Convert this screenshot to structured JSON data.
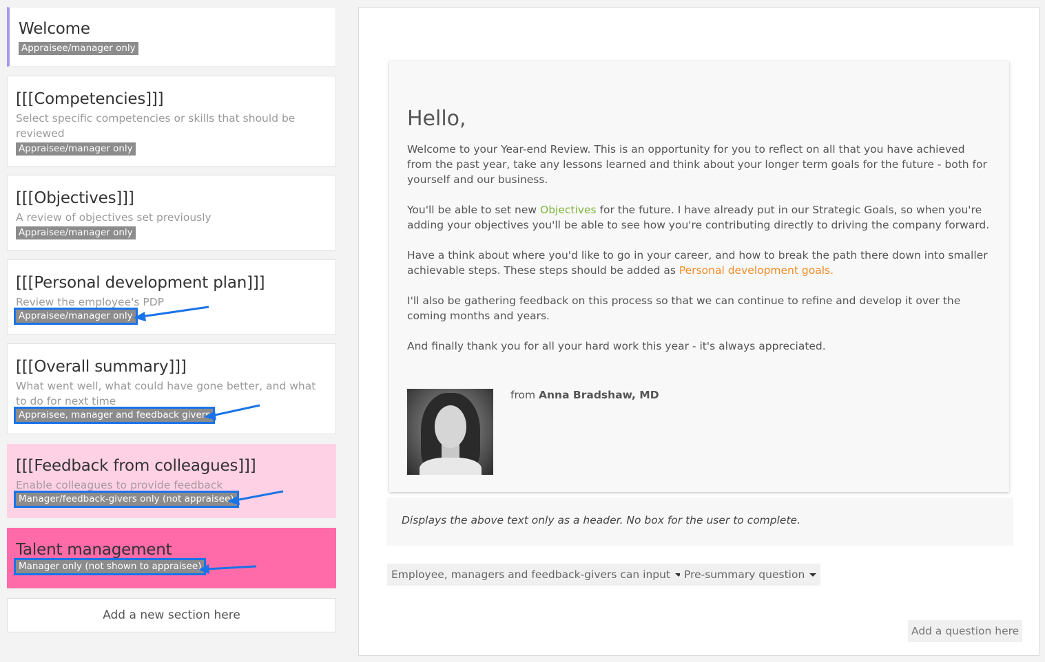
{
  "sections": [
    {
      "title": "Welcome",
      "desc": "",
      "badge": "Appraisee/manager only"
    },
    {
      "title": "[[[Competencies]]]",
      "desc": "Select specific competencies or skills that should be reviewed",
      "badge": "Appraisee/manager only"
    },
    {
      "title": "[[[Objectives]]]",
      "desc": "A review of objectives set previously",
      "badge": "Appraisee/manager only"
    },
    {
      "title": "[[[Personal development plan]]]",
      "desc": "Review the employee's PDP",
      "badge": "Appraisee/manager only"
    },
    {
      "title": "[[[Overall summary]]]",
      "desc": "What went well, what could have gone better, and what to do for next time",
      "badge": "Appraisee, manager and feedback givers"
    },
    {
      "title": "[[[Feedback from colleagues]]]",
      "desc": "Enable colleagues to provide feedback",
      "badge": "Manager/feedback-givers only (not appraisee)"
    },
    {
      "title": "Talent management",
      "desc": "",
      "badge": "Manager only (not shown to appraisee)"
    }
  ],
  "add_section_label": "Add a new section here",
  "welcome": {
    "greeting": "Hello,",
    "p1": "Welcome to your Year-end Review.  This is an opportunity for you to reflect on all that you have achieved from the past year, take any lessons learned and think about your longer term goals for the future - both for yourself and our business.",
    "p2_a": "You'll be able to set new ",
    "p2_link": "Objectives",
    "p2_b": " for the future. I have already put in our Strategic Goals, so when you're adding your objectives you'll be able to see how you're contributing directly to driving the company forward.",
    "p3_a": "Have a think about where you'd like to go in your career, and how to break the path there down into smaller achievable steps. These steps should be added as ",
    "p3_link": "Personal development goals.",
    "p4": "I'll also be gathering feedback on this process so that we can continue to refine and develop it over the coming months and years.",
    "p5": "And finally thank you for all your hard work this year - it's always appreciated.",
    "from_label": "from ",
    "from_name": "Anna Bradshaw, MD"
  },
  "note": "Displays the above text only as a header. No box for the user to complete.",
  "input_permission_dropdown": "Employee, managers and feedback-givers can input",
  "question_type_dropdown": "Pre-summary question",
  "add_question_label": "Add a question here",
  "colors": {
    "active_bar": "#a59ae6",
    "pink_light": "#ffd1e4",
    "pink_strong": "#ff6aa9",
    "highlight": "#1a73e8",
    "link_green": "#7fb53a",
    "link_orange": "#f08a24"
  }
}
